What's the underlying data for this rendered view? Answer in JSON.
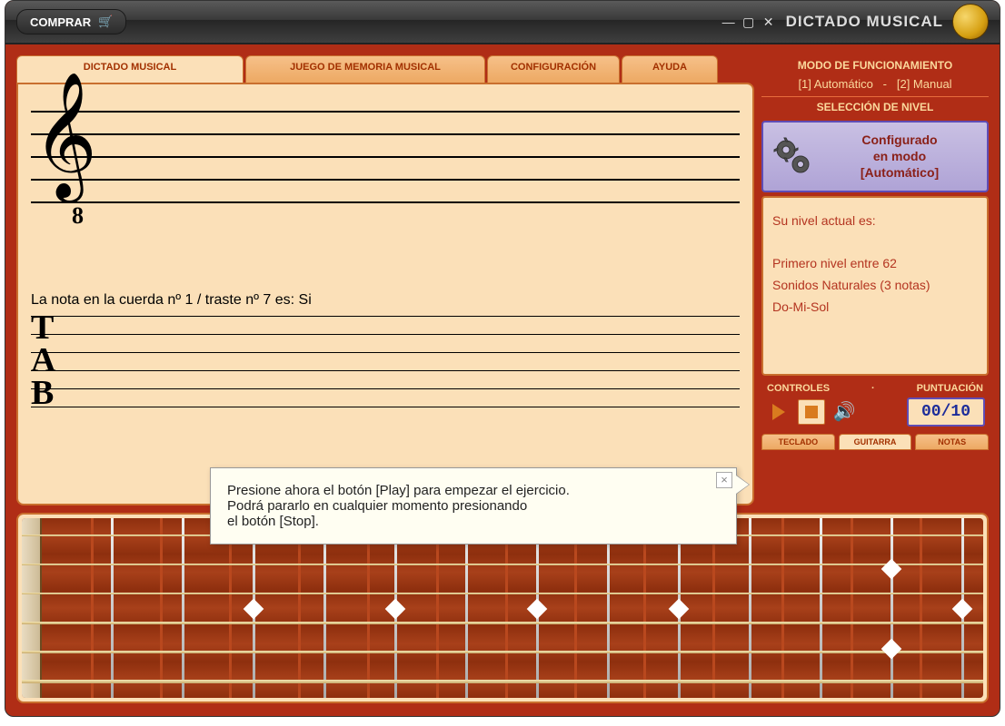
{
  "titlebar": {
    "buy_label": "COMPRAR",
    "app_title": "DICTADO MUSICAL"
  },
  "tabs": {
    "dictado": "DICTADO MUSICAL",
    "memoria": "JUEGO DE MEMORIA MUSICAL",
    "config": "CONFIGURACIÓN",
    "ayuda": "AYUDA"
  },
  "staff": {
    "clef_sub": "8",
    "note_text": "La nota en la cuerda nº 1 / traste nº 7 es: Si",
    "tab_T": "T",
    "tab_A": "A",
    "tab_B": "B"
  },
  "sidebar": {
    "mode_title": "MODO DE FUNCIONAMIENTO",
    "mode_auto": "[1] Automático",
    "mode_sep": "-",
    "mode_manual": "[2] Manual",
    "level_title": "SELECCIÓN DE NIVEL",
    "config_line1": "Configurado",
    "config_line2": "en modo",
    "config_line3": "[Automático]",
    "level_info_line1": "Su nivel actual es:",
    "level_info_line2": "Primero nivel entre 62",
    "level_info_line3": "Sonidos Naturales (3 notas)",
    "level_info_line4": "Do-Mi-Sol",
    "controls_label": "CONTROLES",
    "controls_sep": "·",
    "score_label": "PUNTUACIÓN",
    "score_value": "00/10",
    "input_teclado": "TECLADO",
    "input_guitarra": "GUITARRA",
    "input_notas": "NOTAS"
  },
  "tooltip": {
    "line1": "Presione ahora el botón [Play] para empezar el ejercicio.",
    "line2": "Podrá pararlo en cualquier momento presionando",
    "line3": "el botón [Stop]."
  }
}
